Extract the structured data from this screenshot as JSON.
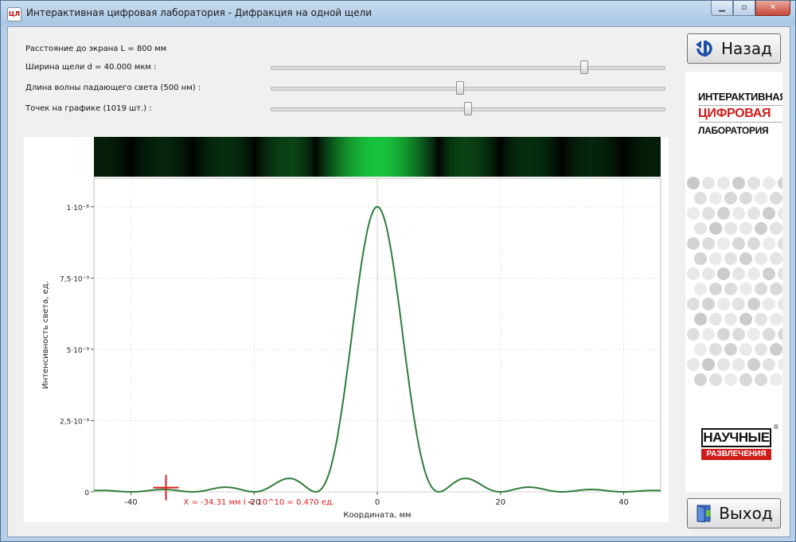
{
  "window": {
    "title": "Интерактивная цифровая лаборатория - Дифракция на одной щели",
    "icon_text": "ЦЛ",
    "min_glyph": "▁",
    "max_glyph": "▫",
    "close_glyph": "✕"
  },
  "params": {
    "distance_label": "Расстояние до экрана L = 800 мм",
    "width_label": "Ширина щели d = 40.000 мкм :",
    "wavelength_label": "Длина волны падающего света (500 нм) :",
    "points_label": "Точек на графике (1019 шт.) :",
    "width_slider_fraction": 0.795,
    "wavelength_slider_fraction": 0.48,
    "points_slider_fraction": 0.5
  },
  "chart_data": {
    "type": "line",
    "xlabel": "Координата, мм",
    "ylabel": "Интенсивность света, ед.",
    "xlim": [
      -46,
      46
    ],
    "ylim": [
      0,
      1.1e-08
    ],
    "x_ticks": [
      -40,
      -20,
      0,
      20,
      40
    ],
    "x_tick_labels": [
      "-40",
      "-20",
      "0",
      "20",
      "40"
    ],
    "y_ticks": [
      0,
      2.5e-09,
      5e-09,
      7.5e-09,
      1e-08
    ],
    "y_tick_labels": [
      "0",
      "2,5·10⁻⁹",
      "5·10⁻⁹",
      "7,5·10⁻⁹",
      "1·10⁻⁸"
    ],
    "grid": true,
    "series_color": "#2e7d3a",
    "peak": 1e-08,
    "slit_width_um": 40,
    "wavelength_nm": 500,
    "screen_distance_mm": 800,
    "points": 1019,
    "cursor": {
      "x": -34.31,
      "y": 1.5e-10,
      "readout": "X = -34.31 мм    I = 10^10 = 0.470 ед."
    },
    "pattern_color": "#19c23c"
  },
  "side": {
    "back_label": "Назад",
    "exit_label": "Выход",
    "logo_line1": "ИНТЕРАКТИВНАЯ",
    "logo_line2": "ЦИФРОВАЯ",
    "logo_line3": "ЛАБОРАТОРИЯ",
    "brand_top": "НАУЧНЫЕ",
    "brand_bottom": "РАЗВЛЕЧЕНИЯ",
    "reg": "®"
  }
}
